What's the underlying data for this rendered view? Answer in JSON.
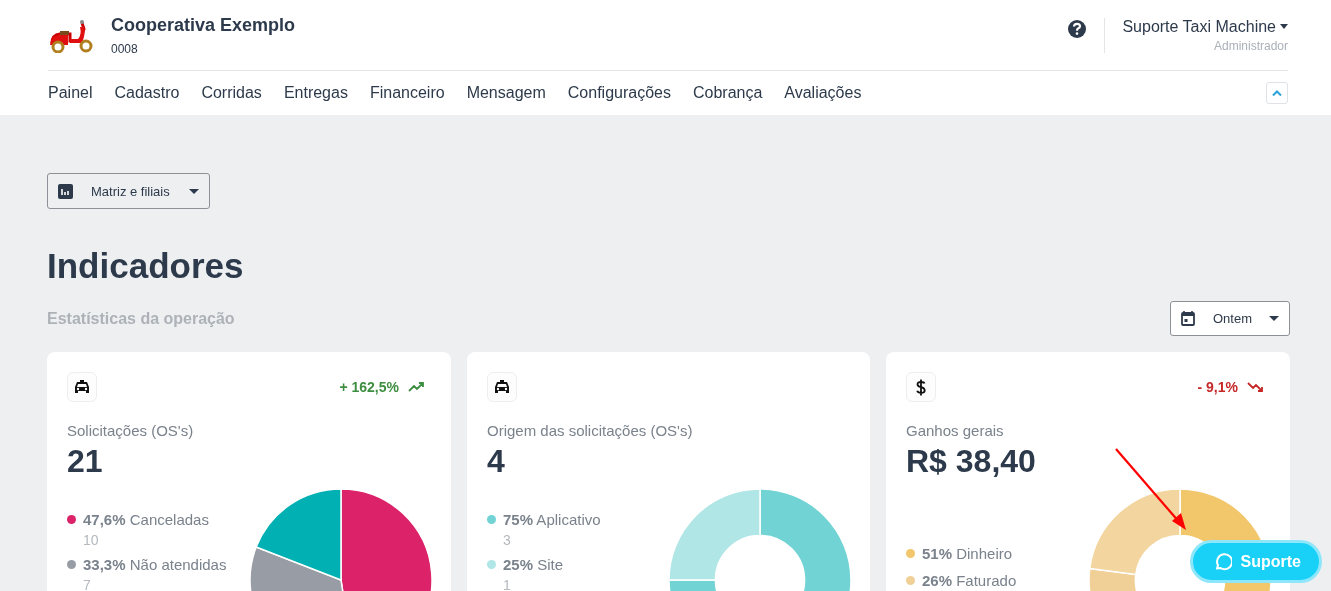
{
  "header": {
    "company": "Cooperativa Exemplo",
    "code": "0008",
    "user": "Suporte Taxi Machine",
    "role": "Administrador"
  },
  "nav": [
    "Painel",
    "Cadastro",
    "Corridas",
    "Entregas",
    "Financeiro",
    "Mensagem",
    "Configurações",
    "Cobrança",
    "Avaliações"
  ],
  "filter": {
    "label": "Matriz e filiais"
  },
  "page": {
    "title": "Indicadores",
    "subtitle": "Estatísticas da operação"
  },
  "period": {
    "label": "Ontem"
  },
  "cards": [
    {
      "kind": "taxi",
      "change": {
        "kind": "up",
        "text": "+ 162,5%"
      },
      "title": "Solicitações (OS's)",
      "value": "21",
      "legend": [
        {
          "percent": "47,6%",
          "label": "Canceladas",
          "count": "10",
          "color": "#dc2369"
        },
        {
          "percent": "33,3%",
          "label": "Não atendidas",
          "count": "7",
          "color": "#979ca5"
        }
      ],
      "chart_data": {
        "type": "pie",
        "values": [
          47.6,
          33.3,
          19.1
        ],
        "colors": [
          "#dc2369",
          "#979ca5",
          "#00b0b2"
        ]
      }
    },
    {
      "kind": "taxi",
      "title": "Origem das solicitações (OS's)",
      "value": "4",
      "legend": [
        {
          "percent": "75%",
          "label": "Aplicativo",
          "count": "3",
          "color": "#71d3d4"
        },
        {
          "percent": "25%",
          "label": "Site",
          "count": "1",
          "color": "#b0e6e6"
        }
      ],
      "chart_data": {
        "type": "donut",
        "values": [
          75,
          25
        ],
        "colors": [
          "#71d3d4",
          "#b0e6e6"
        ]
      }
    },
    {
      "kind": "money",
      "change": {
        "kind": "down",
        "text": "- 9,1%"
      },
      "title": "Ganhos gerais",
      "value": "R$ 38,40",
      "legend": [
        {
          "percent": "51%",
          "label": "Dinheiro",
          "color": "#f2c66b"
        },
        {
          "percent": "26%",
          "label": "Faturado",
          "color": "#f0d096"
        }
      ],
      "chart_data": {
        "type": "donut",
        "values": [
          51,
          26,
          23
        ],
        "colors": [
          "#f2c66b",
          "#f0d096",
          "#f3d5a0"
        ]
      }
    }
  ],
  "support_button": {
    "label": "Suporte"
  }
}
